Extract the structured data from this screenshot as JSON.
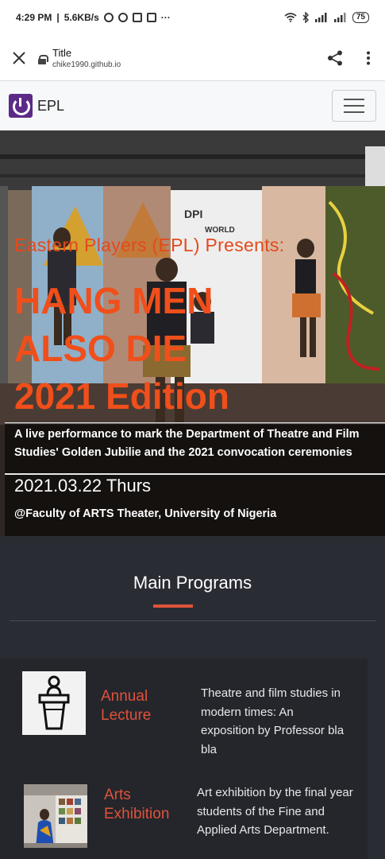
{
  "status_bar": {
    "time": "4:29 PM",
    "speed": "5.6KB/s",
    "battery": "75"
  },
  "browser": {
    "page_title": "Title",
    "domain": "chike1990.github.io"
  },
  "navbar": {
    "brand": "EPL"
  },
  "hero": {
    "presents": "Eastern Players (EPL) Presents:",
    "title_lines": [
      "HANG MEN",
      "ALSO DIE",
      "2021 Edition"
    ],
    "description": "A live performance to mark the Department of Theatre and Film Studies' Golden Jubilie and the 2021 convocation ceremonies",
    "date": "2021.03.22 Thurs",
    "venue": "@Faculty of ARTS Theater, University of Nigeria"
  },
  "programs": {
    "heading": "Main Programs",
    "items": [
      {
        "name_lines": [
          "Annual",
          "Lecture"
        ],
        "description": "Theatre and film studies in modern times: An exposition by Professor bla bla",
        "icon": "lectern-icon"
      },
      {
        "name_lines": [
          "Arts",
          "Exhibition"
        ],
        "description": "Art exhibition by the final year students of the Fine and Applied Arts Department.",
        "icon": "exhibition-photo"
      }
    ]
  },
  "colors": {
    "accent": "#e0523a",
    "hero_title": "#f04f1b",
    "background": "#2a2c33",
    "brand": "#5b2a86"
  }
}
